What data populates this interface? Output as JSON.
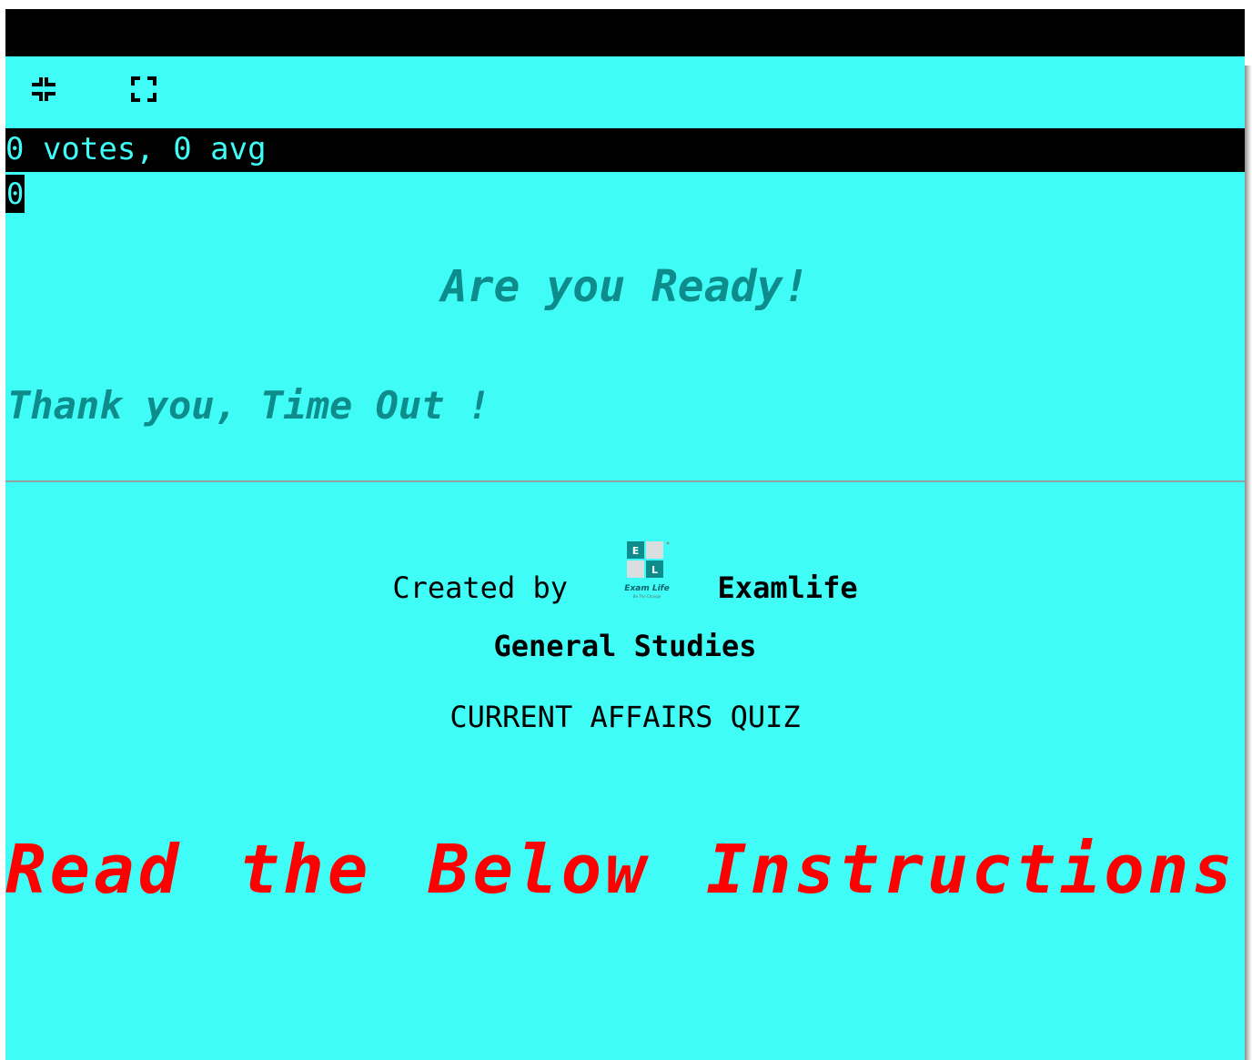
{
  "toolbar": {
    "exit_fullscreen_icon": "exit-fullscreen-icon",
    "fullscreen_icon": "fullscreen-icon"
  },
  "rating": {
    "summary": "0 votes, 0 avg",
    "count": "0"
  },
  "quiz": {
    "ready_heading": "Are you Ready!",
    "timeout_message": "Thank you, Time Out !",
    "created_by_label": "Created by",
    "creator_name": "Examlife",
    "subject": "General Studies",
    "title": "CURRENT AFFAIRS QUIZ",
    "instructions_heading": "Read the Below Instructions"
  },
  "logo": {
    "letter_e": "E",
    "letter_l": "L",
    "wordmark": "Exam Life",
    "tagline": "Be The Change"
  },
  "colors": {
    "background": "#3ffdf6",
    "heading_teal": "#0e8c8c",
    "instructions_red": "#ff0000",
    "bar_black": "#000000"
  }
}
